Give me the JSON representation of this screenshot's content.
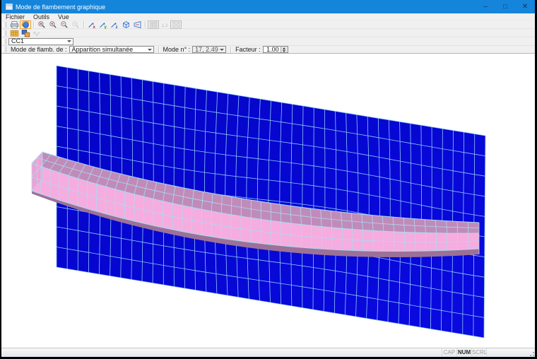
{
  "window": {
    "title": "Mode de flambement graphique",
    "controls": [
      {
        "name": "minimize",
        "glyph": "–"
      },
      {
        "name": "maximize",
        "glyph": "□"
      },
      {
        "name": "close",
        "glyph": "✕"
      }
    ]
  },
  "chrome": {
    "titlebar_color": "#1585db",
    "toolbar_active_bg": "#fdeec9",
    "toolbar_active_border": "#e8a33d"
  },
  "menu": {
    "items": [
      {
        "label": "Fichier"
      },
      {
        "label": "Outils"
      },
      {
        "label": "Vue"
      }
    ]
  },
  "toolbar_main": {
    "buttons": [
      {
        "icon": "print",
        "state": "normal"
      },
      {
        "icon": "rotate-view",
        "state": "active"
      },
      {
        "sep": true
      },
      {
        "icon": "zoom-window",
        "state": "normal"
      },
      {
        "icon": "zoom-in",
        "state": "normal"
      },
      {
        "icon": "zoom-out",
        "state": "normal"
      },
      {
        "icon": "zoom-full",
        "state": "disabled"
      },
      {
        "sep": true
      },
      {
        "icon": "view-x",
        "state": "normal"
      },
      {
        "icon": "view-y",
        "state": "normal"
      },
      {
        "icon": "view-z",
        "state": "normal"
      },
      {
        "icon": "view-isometric",
        "state": "normal"
      },
      {
        "icon": "view-perspective",
        "state": "normal"
      },
      {
        "sep": true
      },
      {
        "icon": "wireframe-toggle",
        "state": "disabled pressed"
      },
      {
        "icon": "values-toggle",
        "state": "disabled"
      },
      {
        "icon": "settings-box",
        "state": "disabled pressed"
      }
    ]
  },
  "toolbar_secondary": {
    "buttons": [
      {
        "icon": "result-table",
        "state": "normal"
      },
      {
        "icon": "tile-windows",
        "state": "normal"
      },
      {
        "icon": "animation",
        "state": "disabled"
      }
    ]
  },
  "case_bar": {
    "value": "CC1"
  },
  "mode_bar": {
    "label_mode": "Mode de flamb. de :",
    "mode_combo": "Apparition simultanée",
    "label_mode_no": "Mode n° :",
    "mode_no_combo": "17, 2.49",
    "label_factor": "Facteur :",
    "factor_value": "1.00"
  },
  "status_bar": {
    "indicators": [
      {
        "label": "CAP",
        "active": false
      },
      {
        "label": "NUM",
        "active": true
      },
      {
        "label": "SCRL",
        "active": false
      }
    ]
  },
  "scene": {
    "description": "buckling-mode-3d-view",
    "colors": {
      "background": "#ffffff",
      "plate_fill": "#0a0ae2",
      "plate_fill_dark": "#0404c4",
      "plate_line": "#8ec8f6",
      "beam_top": "#c08bb9",
      "beam_front": "#f6acdf",
      "beam_cap": "#eda2d4",
      "beam_under": "#9c7198",
      "beam_line": "#aadcf2"
    }
  }
}
